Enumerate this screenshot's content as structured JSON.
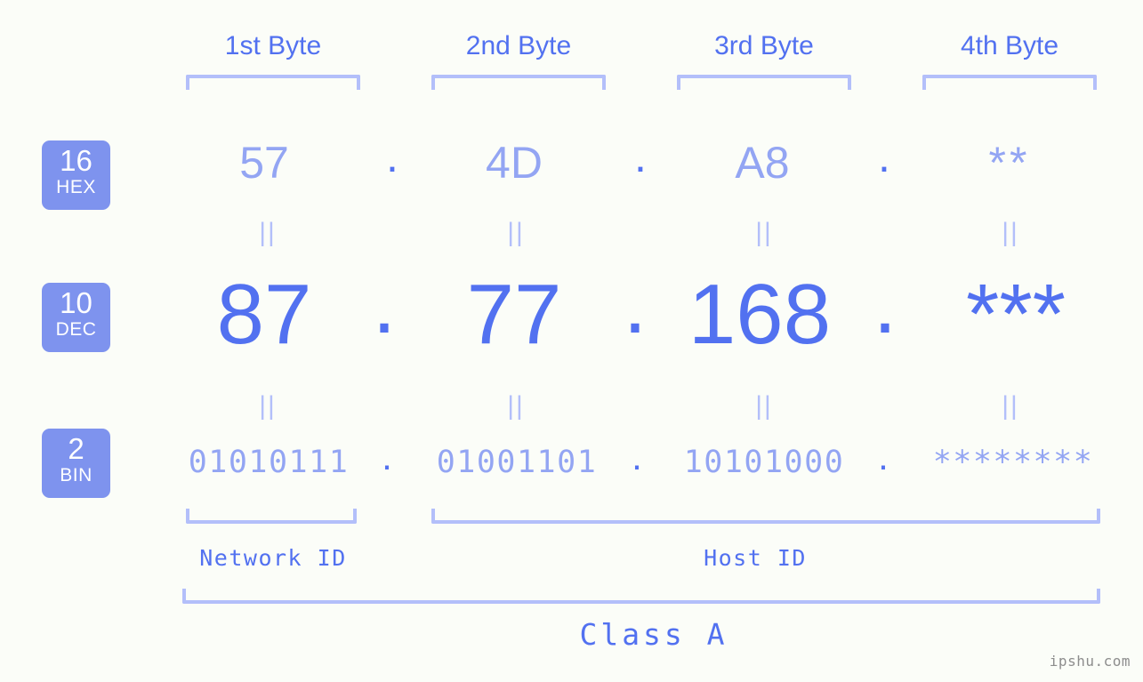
{
  "meta": {
    "watermark": "ipshu.com",
    "background_color": "#fbfdf8",
    "accent_strong": "#5271f0",
    "accent_light": "#93a5f3",
    "accent_bracket": "#b3bffa",
    "badge_bg": "#7e93ee"
  },
  "header": {
    "bytes": [
      {
        "label": "1st Byte"
      },
      {
        "label": "2nd Byte"
      },
      {
        "label": "3rd Byte"
      },
      {
        "label": "4th Byte"
      }
    ]
  },
  "rows": {
    "hex": {
      "badge_number": "16",
      "badge_system": "HEX",
      "separator": ".",
      "values": [
        "57",
        "4D",
        "A8",
        "**"
      ]
    },
    "dec": {
      "badge_number": "10",
      "badge_system": "DEC",
      "separator": ".",
      "values": [
        "87",
        "77",
        "168",
        "***"
      ]
    },
    "bin": {
      "badge_number": "2",
      "badge_system": "BIN",
      "separator": ".",
      "values": [
        "01010111",
        "01001101",
        "10101000",
        "********"
      ]
    }
  },
  "connectors": {
    "symbol": "||"
  },
  "footer": {
    "network_id_label": "Network ID",
    "host_id_label": "Host ID",
    "class_label": "Class A"
  }
}
